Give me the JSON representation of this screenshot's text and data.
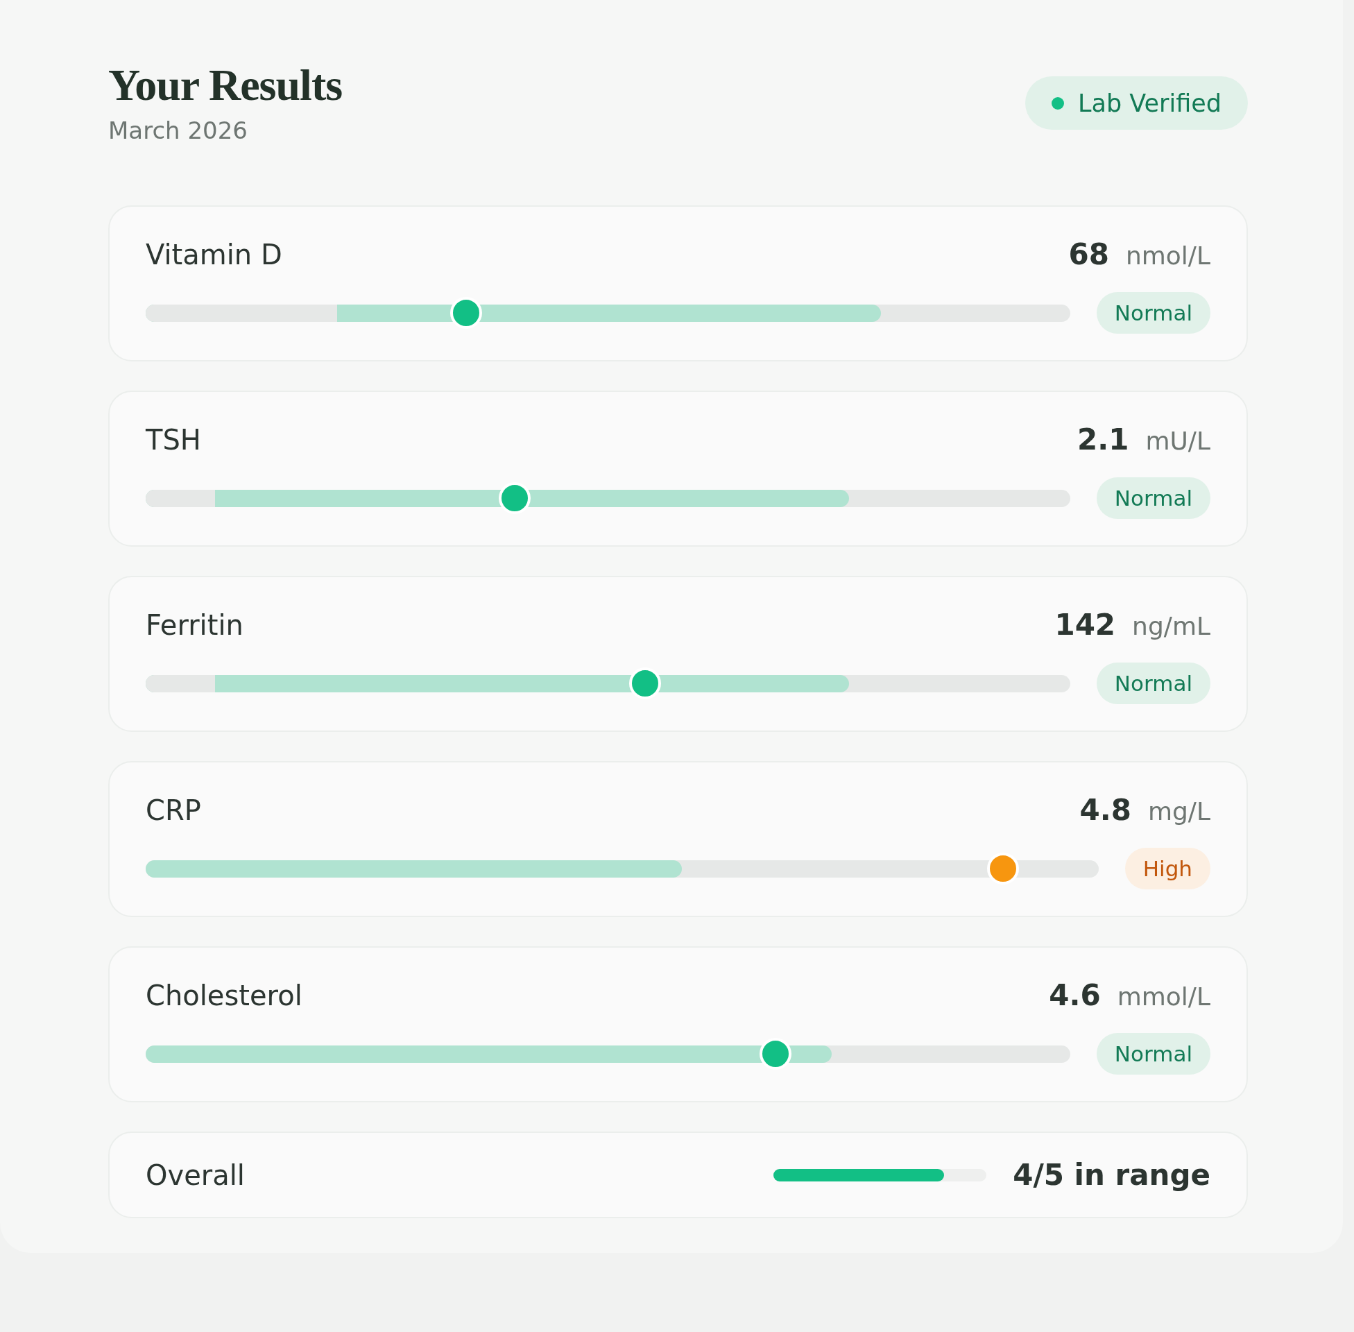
{
  "header": {
    "title": "Your Results",
    "subtitle": "March 2026",
    "badge": {
      "label": "Lab Verified"
    }
  },
  "metrics": [
    {
      "name": "Vitamin D",
      "value": "68",
      "unit": "nmol/L",
      "range": {
        "start": {
          "level": 0.207
        },
        "end": {
          "level": 0.795
        }
      },
      "level": 0.347,
      "status": {
        "label": "Normal",
        "kind": "normal"
      }
    },
    {
      "name": "TSH",
      "value": "2.1",
      "unit": "mU/L",
      "range": {
        "start": {
          "level": 0.075
        },
        "end": {
          "level": 0.761
        }
      },
      "level": 0.399,
      "status": {
        "label": "Normal",
        "kind": "normal"
      }
    },
    {
      "name": "Ferritin",
      "value": "142",
      "unit": "ng/mL",
      "range": {
        "start": {
          "level": 0.075
        },
        "end": {
          "level": 0.761
        }
      },
      "level": 0.54,
      "status": {
        "label": "Normal",
        "kind": "normal"
      }
    },
    {
      "name": "CRP",
      "value": "4.8",
      "unit": "mg/L",
      "range": {
        "end": {
          "level": 0.563
        }
      },
      "level": 0.9,
      "status": {
        "label": "High",
        "kind": "high"
      }
    },
    {
      "name": "Cholesterol",
      "value": "4.6",
      "unit": "mmol/L",
      "range": {
        "end": {
          "level": 0.742
        }
      },
      "level": 0.681,
      "status": {
        "label": "Normal",
        "kind": "normal"
      }
    }
  ],
  "overall": {
    "label": "Overall",
    "level": 0.8,
    "summary": "4/5 in range"
  }
}
